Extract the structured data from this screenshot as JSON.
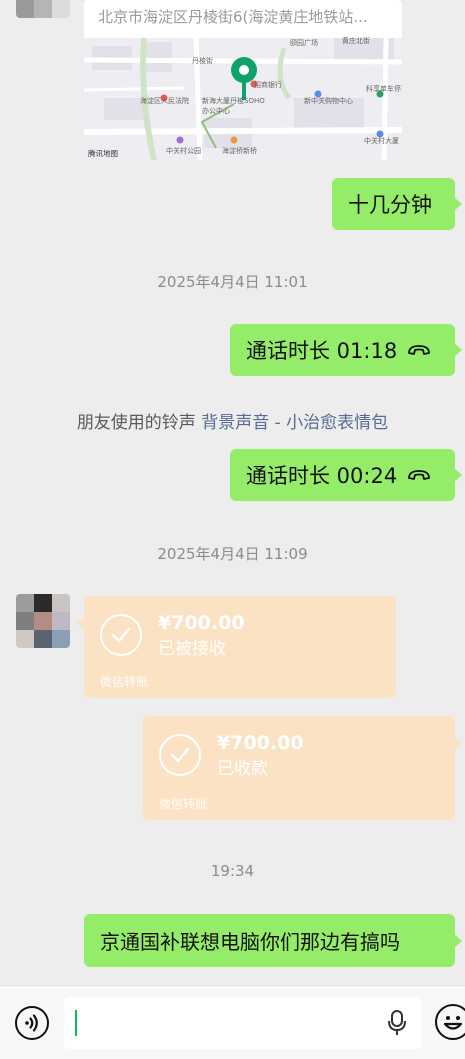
{
  "location_card": {
    "address": "北京市海淀区丹棱街6(海淀黄庄地铁站...",
    "map_labels": [
      "丹棱街",
      "颐园广场",
      "黄庄北街",
      "招商银行",
      "丹棱SOHO",
      "海淀区人民法院",
      "新海大厦",
      "办公中心",
      "新中关购物中心",
      "科享单车停车",
      "中关村公园",
      "海淀桥新桥",
      "中关村大厦"
    ],
    "map_credit": "腾讯地图"
  },
  "messages": {
    "shijifen": "十几分钟",
    "ts1": "2025年4月4日 11:01",
    "call1": "通话时长 01:18",
    "ringtone_prefix": "朋友使用的铃声",
    "ringtone_link": "背景声音 - 小治愈表情包",
    "call2": "通话时长 00:24",
    "ts2": "2025年4月4日 11:09",
    "ts3": "19:34",
    "last": "京通国补联想电脑你们那边有搞吗"
  },
  "transfers": [
    {
      "amount": "¥700.00",
      "status": "已被接收",
      "label": "微信转账"
    },
    {
      "amount": "¥700.00",
      "status": "已收款",
      "label": "微信转账"
    }
  ],
  "input": {
    "value": ""
  },
  "icons": {
    "voice": "voice-icon",
    "mic": "microphone-icon",
    "emoji": "emoji-icon",
    "call": "phone-hangup-icon"
  },
  "colors": {
    "bubble_green": "#95ec69",
    "transfer_orange": "#fce2c4",
    "link": "#576b95",
    "caret": "#07c160"
  }
}
